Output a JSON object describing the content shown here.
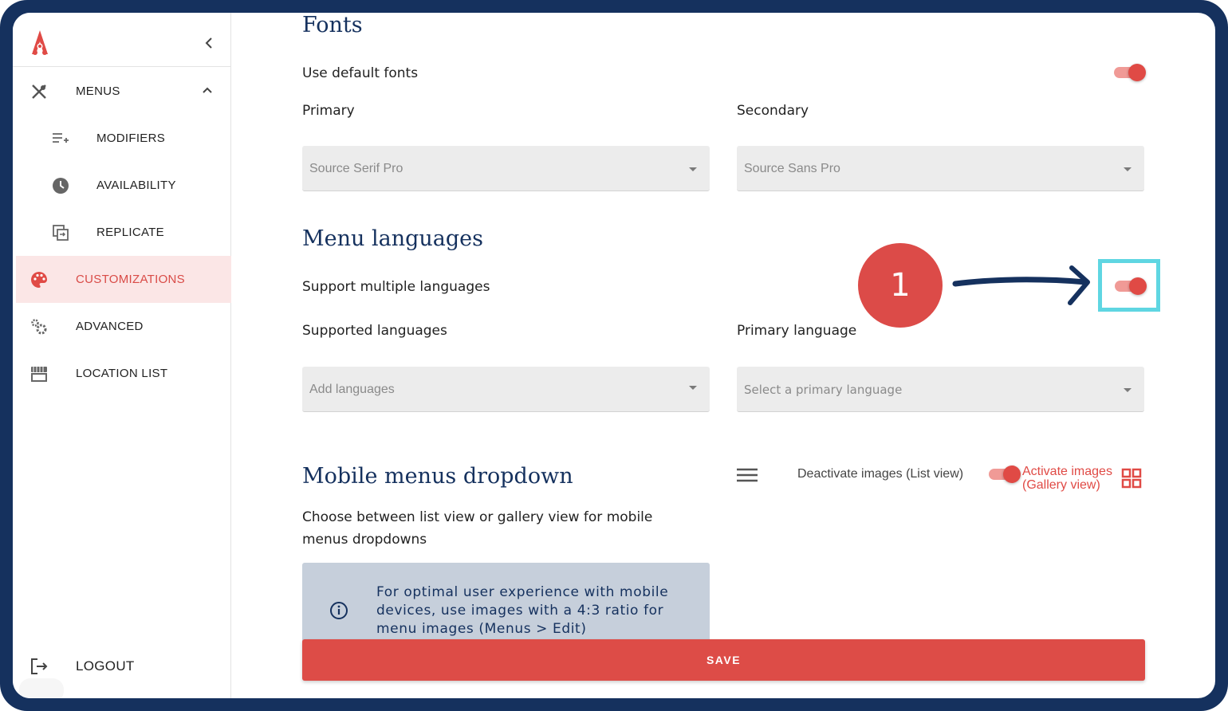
{
  "sidebar": {
    "items": [
      {
        "label": "MENUS",
        "icon": "utensils-icon"
      },
      {
        "label": "MODIFIERS",
        "icon": "playlist-add-icon"
      },
      {
        "label": "AVAILABILITY",
        "icon": "clock-icon"
      },
      {
        "label": "REPLICATE",
        "icon": "copy-icon"
      },
      {
        "label": "CUSTOMIZATIONS",
        "icon": "palette-icon"
      },
      {
        "label": "ADVANCED",
        "icon": "gears-icon"
      },
      {
        "label": "LOCATION LIST",
        "icon": "store-icon"
      }
    ],
    "logout_label": "LOGOUT",
    "active_color": "#d94b47"
  },
  "fonts": {
    "heading": "Fonts",
    "use_default_label": "Use default fonts",
    "use_default_on": true,
    "primary_label": "Primary",
    "primary_value": "Source Serif Pro",
    "secondary_label": "Secondary",
    "secondary_value": "Source Sans Pro"
  },
  "languages": {
    "heading": "Menu languages",
    "support_multiple_label": "Support multiple languages",
    "support_multiple_on": true,
    "supported_label": "Supported languages",
    "supported_placeholder": "Add languages",
    "primary_label": "Primary language",
    "primary_placeholder": "Select a primary language"
  },
  "annotation": {
    "step_number": "1",
    "highlight_color": "#5fd6e2"
  },
  "mobile_menus": {
    "heading": "Mobile menus dropdown",
    "description": "Choose between list view or gallery view for mobile menus dropdowns",
    "deactivate_label": "Deactivate images (List view)",
    "activate_label_line1": "Activate images",
    "activate_label_line2": "(Gallery view)",
    "gallery_on": true,
    "info_text": "For optimal user experience with mobile devices, use images with a 4:3 ratio for menu images (Menus > Edit)"
  },
  "save_label": "SAVE",
  "colors": {
    "brand_navy": "#15315e",
    "accent_red": "#dd4c47"
  }
}
